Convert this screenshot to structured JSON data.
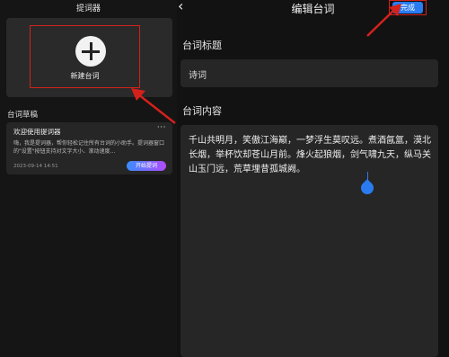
{
  "left_panel": {
    "title": "提词器",
    "new_script": {
      "label": "新建台词"
    },
    "drafts_label": "台词草稿",
    "draft": {
      "title": "欢迎使用提词器",
      "more": "···",
      "body": "嗨，我是提词器，帮你轻松记住所有台词的小助手。提词器窗口的\"设置\"按钮支持对文字大小、滚动速度...",
      "date": "2023-09-14 14:51",
      "action": "开始提词"
    }
  },
  "right_panel": {
    "back": "‹",
    "title": "编辑台词",
    "done": "完成",
    "title_label": "台词标题",
    "title_value": "诗词",
    "content_label": "台词内容",
    "content_value": "千山共明月，笑傲江海巅，一梦浮生莫叹远。煮酒氤氲，漠北长烟，举杯饮却苍山月前。烽火起狼烟，剑气啸九天，纵马关山玉门远，荒草埋昔孤城阙。"
  },
  "colors": {
    "accent": "#2a7bf0",
    "annotation_red": "#d4211b",
    "background": "#121212",
    "card": "#262626"
  }
}
